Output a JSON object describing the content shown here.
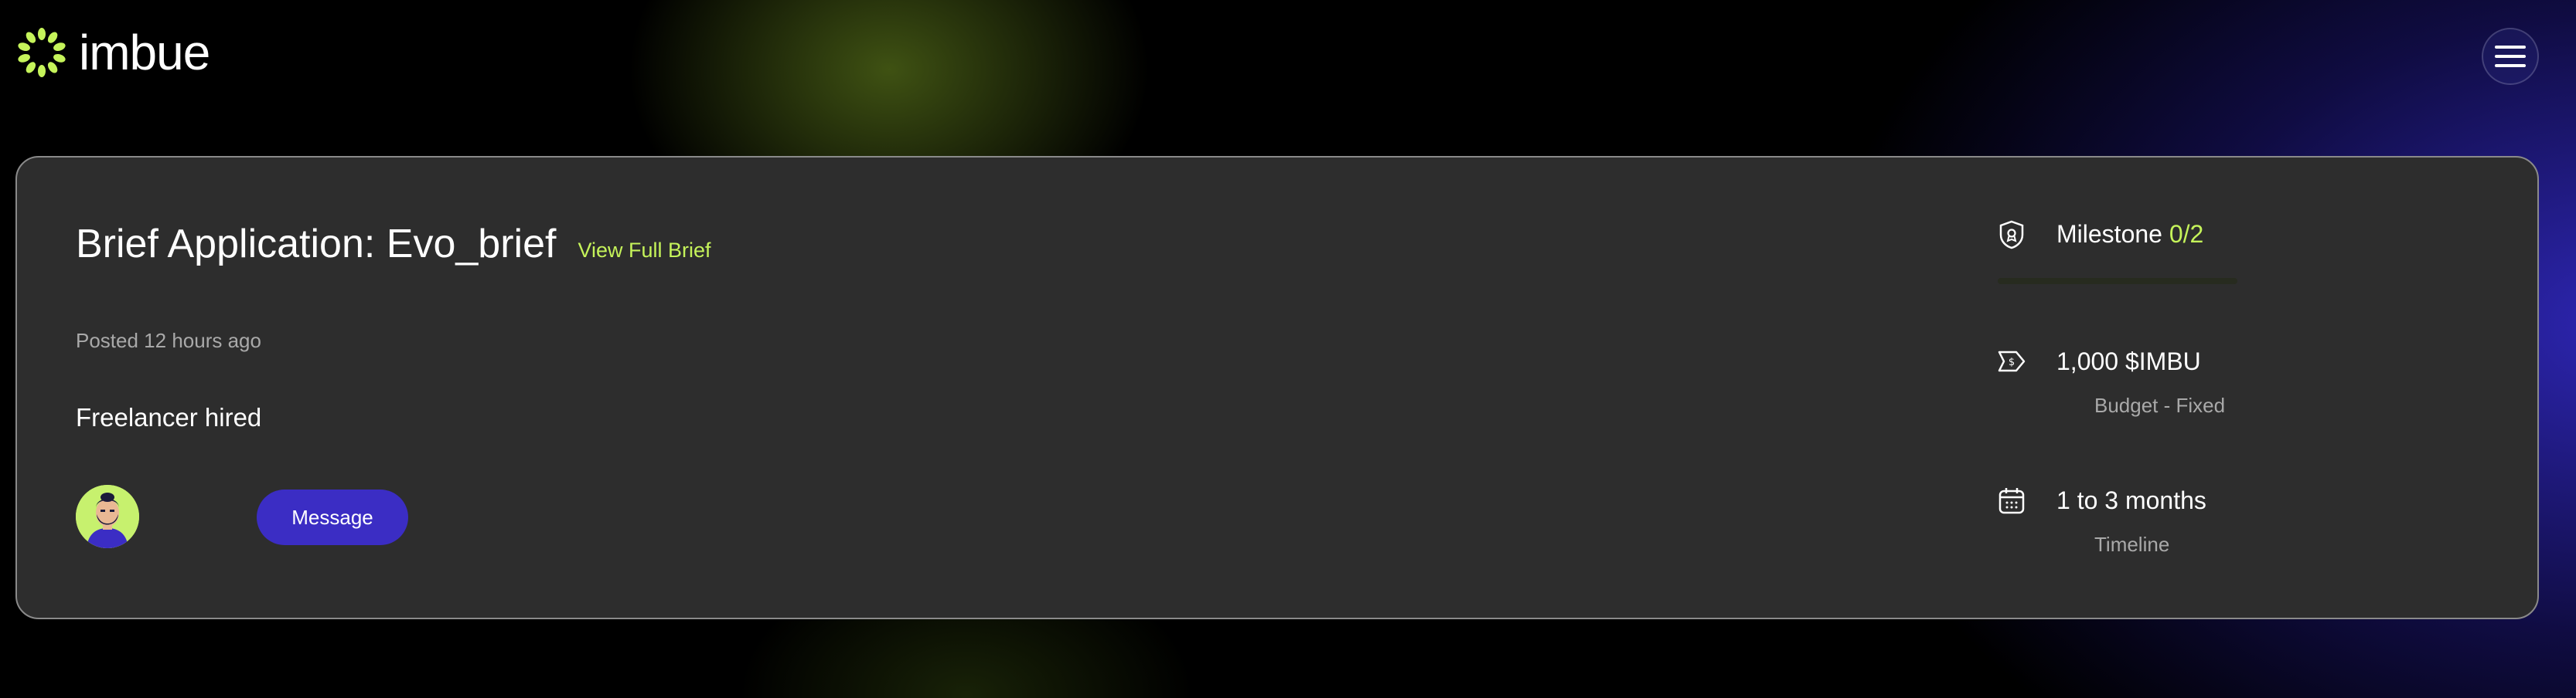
{
  "header": {
    "logo_text": "imbue",
    "menu_icon": "hamburger-menu-icon"
  },
  "brief": {
    "title": "Brief Application: Evo_brief",
    "view_full_brief": "View Full Brief",
    "posted": "Posted 12 hours ago",
    "status": "Freelancer hired",
    "message_label": "Message"
  },
  "milestone": {
    "label": "Milestone",
    "count": "0/2",
    "progress_fraction": 0
  },
  "budget": {
    "amount": "1,000 $IMBU",
    "caption": "Budget - Fixed"
  },
  "timeline": {
    "value": "1 to 3 months",
    "caption": "Timeline"
  },
  "colors": {
    "accent": "#c5f35a",
    "button": "#3b2dc4",
    "card_bg": "#2d2d2d"
  }
}
